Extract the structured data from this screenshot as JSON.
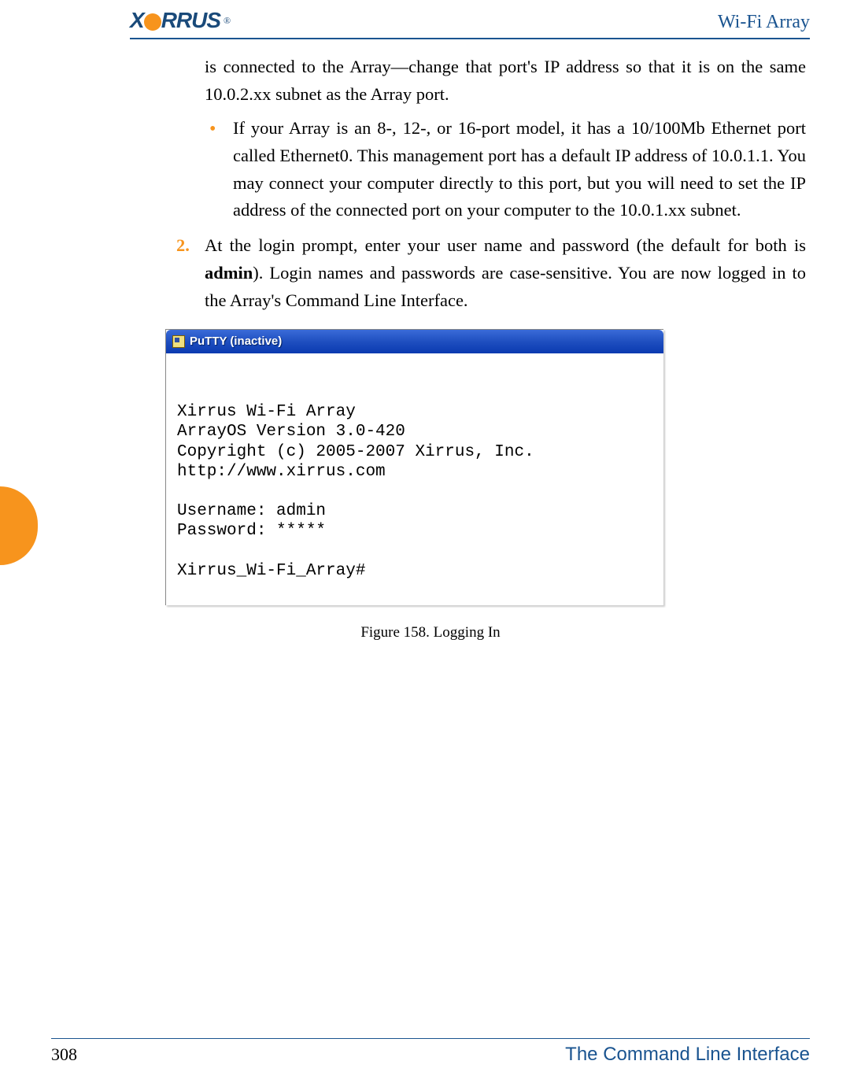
{
  "header": {
    "logo_text": "XIRRUS",
    "logo_reg": "®",
    "title": "Wi-Fi Array"
  },
  "body": {
    "cont_paragraph": "is connected to the Array—change that port's IP address so that it is on the same 10.0.2.xx subnet as the Array port.",
    "bullet1": "If your Array is an 8-, 12-, or 16-port model, it has a 10/100Mb Ethernet port called Ethernet0. This management port has a default IP address of 10.0.1.1. You may connect your computer directly to this port, but you will need to set the IP address of the connected port on your computer to the 10.0.1.xx subnet.",
    "step2_num": "2.",
    "step2_text_pre": "At the login prompt, enter your user name and password (the default for both is ",
    "step2_admin": "admin",
    "step2_text_post": "). Login names and passwords are case-sensitive. You are now logged in to the Array's Command Line Interface."
  },
  "screenshot": {
    "titlebar": "PuTTY (inactive)",
    "terminal": "\n\nXirrus Wi-Fi Array\nArrayOS Version 3.0-420\nCopyright (c) 2005-2007 Xirrus, Inc.\nhttp://www.xirrus.com\n\nUsername: admin\nPassword: *****\n\nXirrus_Wi-Fi_Array#"
  },
  "figure_caption": "Figure 158. Logging In",
  "footer": {
    "page": "308",
    "title": "The Command Line Interface"
  }
}
